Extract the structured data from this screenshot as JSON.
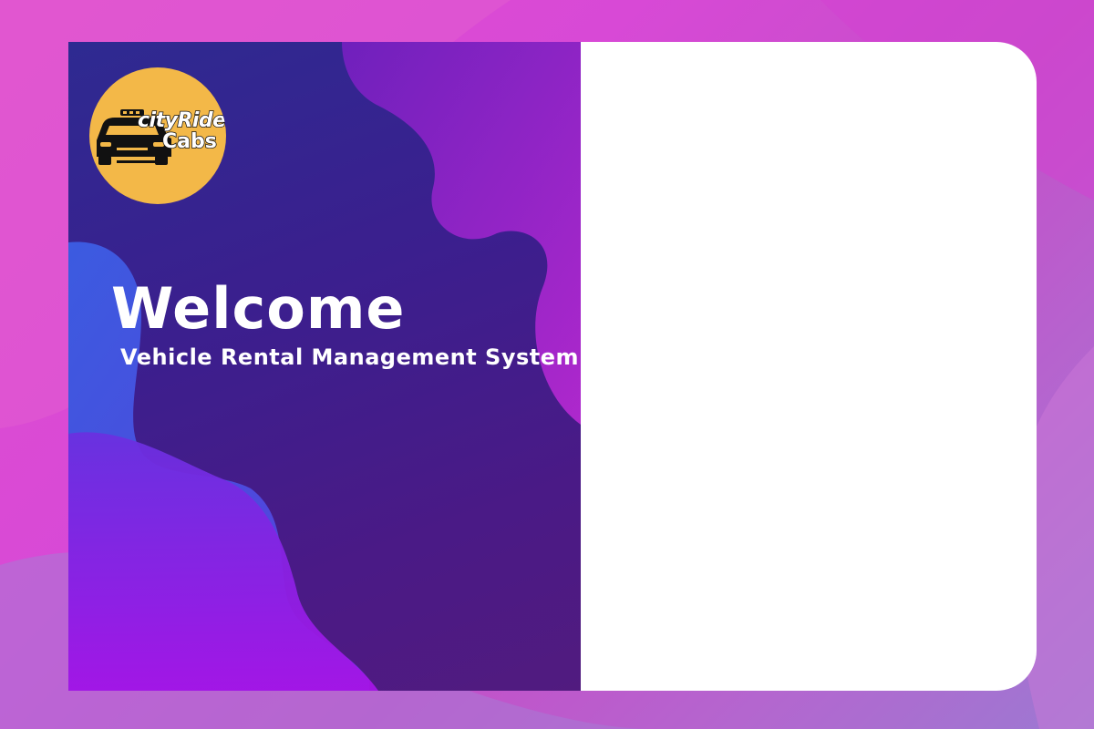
{
  "logo": {
    "icon": "taxi-icon",
    "brand_line1": "cityRides",
    "brand_line2": "Cabs",
    "background_color": "#f3b848"
  },
  "welcome": {
    "title": "Welcome",
    "subtitle": "Vehicle Rental Management System"
  },
  "colors": {
    "panel_dark": "#3b1f8e",
    "accent_magenta": "#d849d6",
    "accent_blue": "#3a5fe0",
    "accent_purple": "#7a22e0",
    "right_panel": "#ffffff"
  }
}
